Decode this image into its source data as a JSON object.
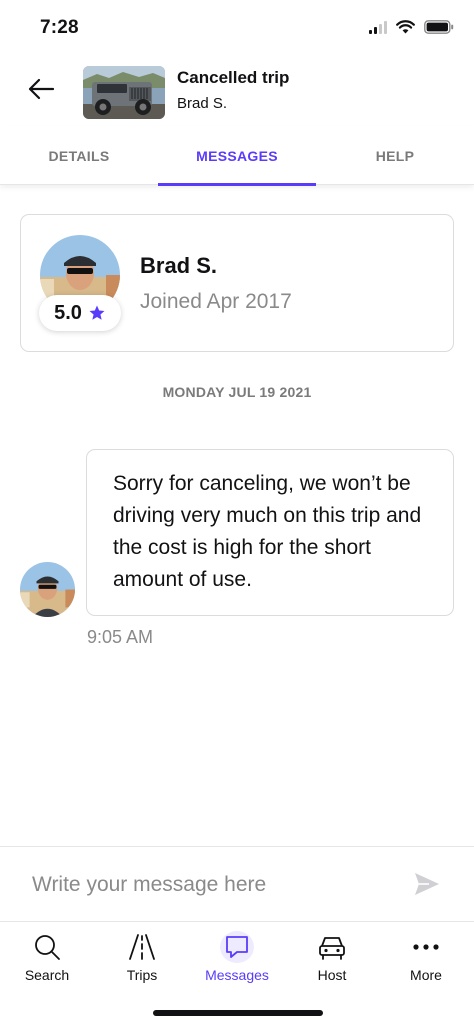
{
  "status_bar": {
    "time": "7:28"
  },
  "header": {
    "title": "Cancelled trip",
    "subtitle": "Brad S."
  },
  "tabs": [
    {
      "label": "DETAILS",
      "active": false
    },
    {
      "label": "MESSAGES",
      "active": true
    },
    {
      "label": "HELP",
      "active": false
    }
  ],
  "host": {
    "name": "Brad S.",
    "joined": "Joined Apr 2017",
    "rating": "5.0"
  },
  "conversation": {
    "date": "MONDAY JUL 19 2021",
    "messages": [
      {
        "text": "Sorry for canceling, we won’t be driving very much on this trip and the cost is high for the short amount of use.",
        "time": "9:05 AM"
      }
    ]
  },
  "compose": {
    "placeholder": "Write your message here"
  },
  "bottom_nav": [
    {
      "label": "Search",
      "icon": "search-icon",
      "active": false
    },
    {
      "label": "Trips",
      "icon": "road-icon",
      "active": false
    },
    {
      "label": "Messages",
      "icon": "chat-icon",
      "active": true
    },
    {
      "label": "Host",
      "icon": "car-icon",
      "active": false
    },
    {
      "label": "More",
      "icon": "more-dots-icon",
      "active": false
    }
  ],
  "colors": {
    "accent": "#593cfb",
    "text": "#121214",
    "muted": "#8a8a8a",
    "border": "#dcdcdc"
  }
}
